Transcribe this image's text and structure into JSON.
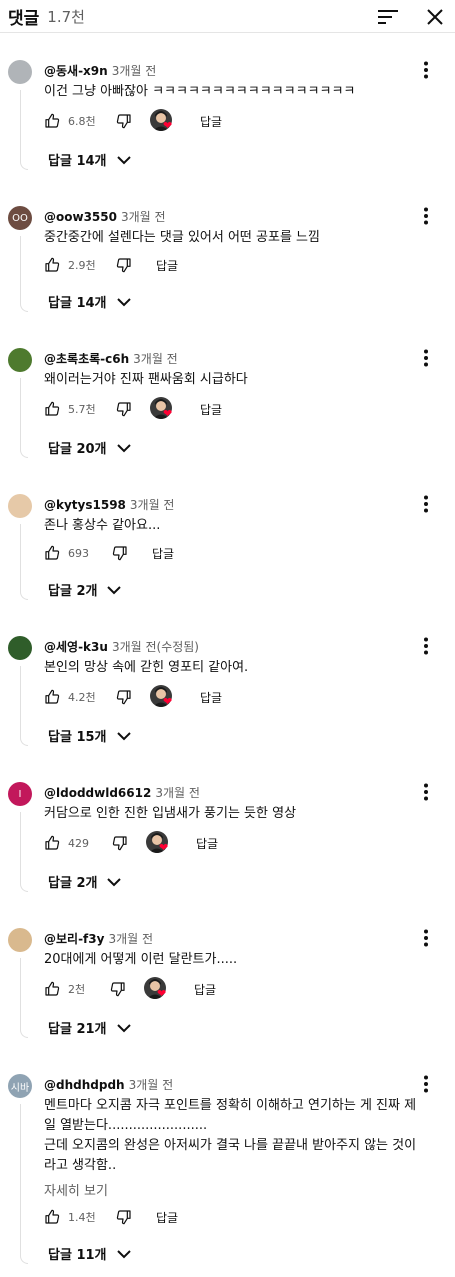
{
  "header": {
    "title": "댓글",
    "count": "1.7천"
  },
  "comments": [
    {
      "avatar": "",
      "author": "@동새-x9n",
      "time": "3개월 전",
      "text": "이건 그냥 아빠잖아 ㅋㅋㅋㅋㅋㅋㅋㅋㅋㅋㅋㅋㅋㅋㅋㅋㅋ",
      "likes": "6.8천",
      "reply_label": "답글",
      "replies": "답글 14개",
      "avatar_color": "#b0b4b8",
      "creator_heart": true
    },
    {
      "avatar": "OO",
      "author": "@oow3550",
      "time": "3개월 전",
      "text": "중간중간에 설렌다는 댓글 있어서 어떤 공포를 느낌",
      "likes": "2.9천",
      "reply_label": "답글",
      "replies": "답글 14개",
      "avatar_color": "#6d4c41",
      "creator_heart": false
    },
    {
      "avatar": "",
      "author": "@초록초록-c6h",
      "time": "3개월 전",
      "text": "왜이러는거야 진짜 팬싸움회 시급하다",
      "likes": "5.7천",
      "reply_label": "답글",
      "replies": "답글 20개",
      "avatar_color": "#4e7a2e",
      "creator_heart": true
    },
    {
      "avatar": "",
      "author": "@kytys1598",
      "time": "3개월 전",
      "text": "존나 홍상수 같아요...",
      "likes": "693",
      "reply_label": "답글",
      "replies": "답글 2개",
      "avatar_color": "#e6c9a8",
      "creator_heart": false
    },
    {
      "avatar": "",
      "author": "@세영-k3u",
      "time": "3개월 전(수정됨)",
      "text": "본인의 망상 속에 갇힌 영포티 같아여.",
      "likes": "4.2천",
      "reply_label": "답글",
      "replies": "답글 15개",
      "avatar_color": "#2f5d2a",
      "creator_heart": true
    },
    {
      "avatar": "I",
      "author": "@ldoddwld6612",
      "time": "3개월 전",
      "text": "커담으로 인한 진한 입냄새가 풍기는 듯한 영상",
      "likes": "429",
      "reply_label": "답글",
      "replies": "답글 2개",
      "avatar_color": "#c2185b",
      "creator_heart": true
    },
    {
      "avatar": "",
      "author": "@보리-f3y",
      "time": "3개월 전",
      "text": "20대에게 어떻게 이런 달란트가.....",
      "likes": "2천",
      "reply_label": "답글",
      "replies": "답글 21개",
      "avatar_color": "#d9b98e",
      "creator_heart": true
    },
    {
      "avatar": "시바",
      "author": "@dhdhdpdh",
      "time": "3개월 전",
      "text": "멘트마다 오지콤 자극 포인트를 정확히 이해하고 연기하는 게 진짜 제일 열받는다........................\n근데 오지콤의 완성은 아저씨가 결국 나를 끝끝내 받아주지 않는 것이라고 생각함..",
      "read_more": "자세히 보기",
      "likes": "1.4천",
      "reply_label": "답글",
      "replies": "답글 11개",
      "avatar_color": "#8fa3b3",
      "creator_heart": false
    }
  ],
  "icons": [
    "sort-icon",
    "close-icon",
    "more-vert-icon",
    "thumb-up-icon",
    "thumb-down-icon",
    "chevron-down-icon",
    "heart-icon"
  ]
}
